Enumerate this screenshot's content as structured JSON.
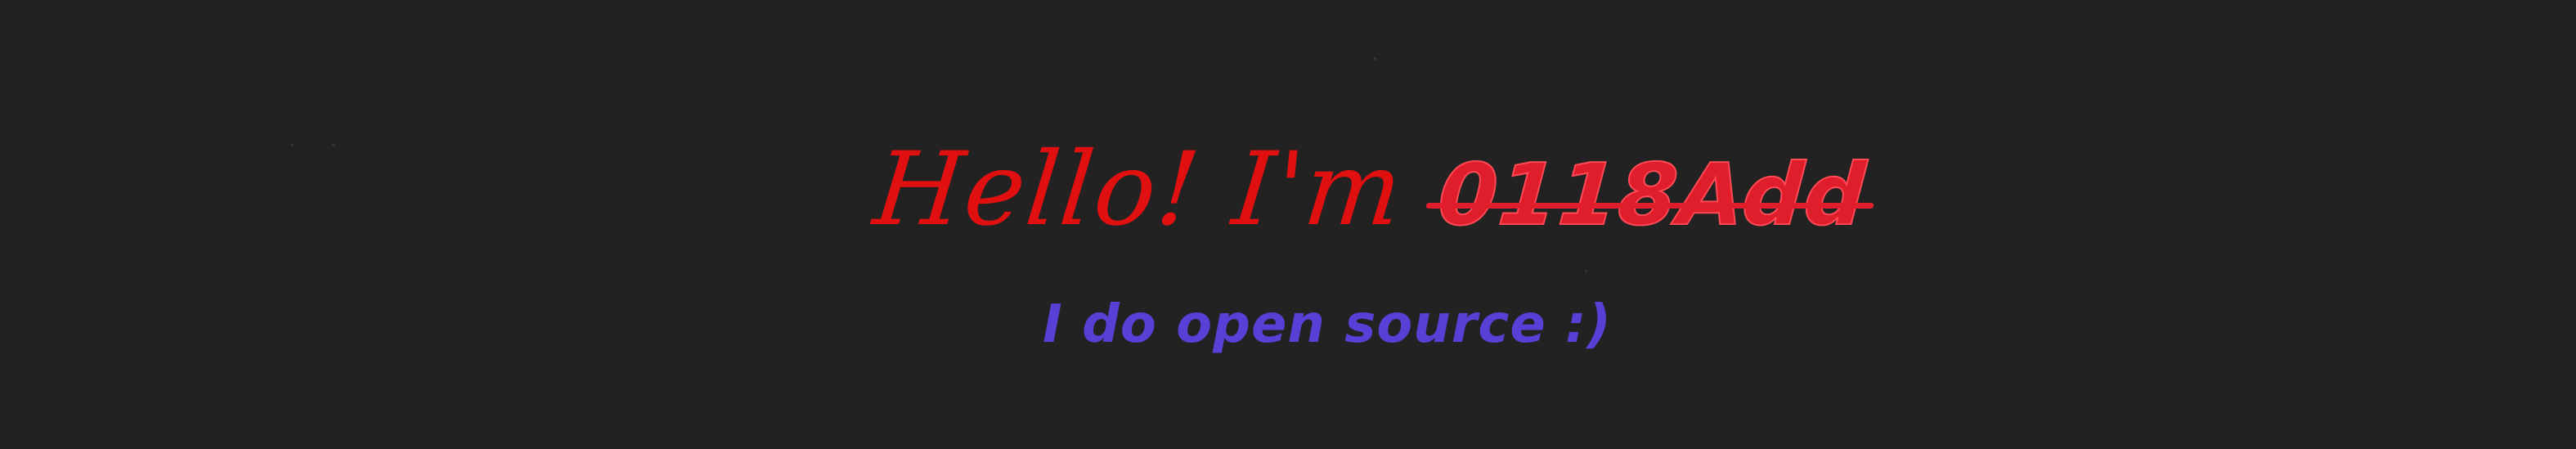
{
  "banner": {
    "greeting": "Hello! I'm",
    "handle": "0118Add",
    "tagline": "I do open source :)"
  },
  "colors": {
    "background": "#222222",
    "greeting": "#e01010",
    "handle": "#e01e2b",
    "tagline": "#5a3fd6"
  }
}
